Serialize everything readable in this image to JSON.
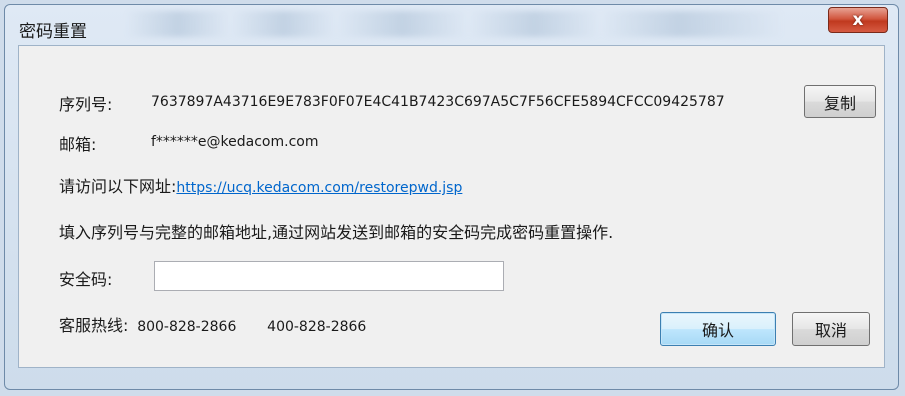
{
  "window": {
    "title": "密码重置",
    "close_glyph": "x"
  },
  "serial": {
    "label": "序列号:",
    "value": "7637897A43716E9E783F0F07E4C41B7423C697A5C7F56CFE5894CFCC09425787",
    "copy_label": "复制"
  },
  "email": {
    "label": "邮箱:",
    "value": "f******e@kedacom.com"
  },
  "visit": {
    "label": "请访问以下网址:",
    "url": "https://ucq.kedacom.com/restorepwd.jsp"
  },
  "instruction": "填入序列号与完整的邮箱地址,通过网站发送到邮箱的安全码完成密码重置操作.",
  "security_code": {
    "label": "安全码:",
    "value": "",
    "placeholder": ""
  },
  "hotline": {
    "label": "客服热线:",
    "number1": "800-828-2866",
    "number2": "400-828-2866"
  },
  "buttons": {
    "ok": "确认",
    "cancel": "取消"
  }
}
